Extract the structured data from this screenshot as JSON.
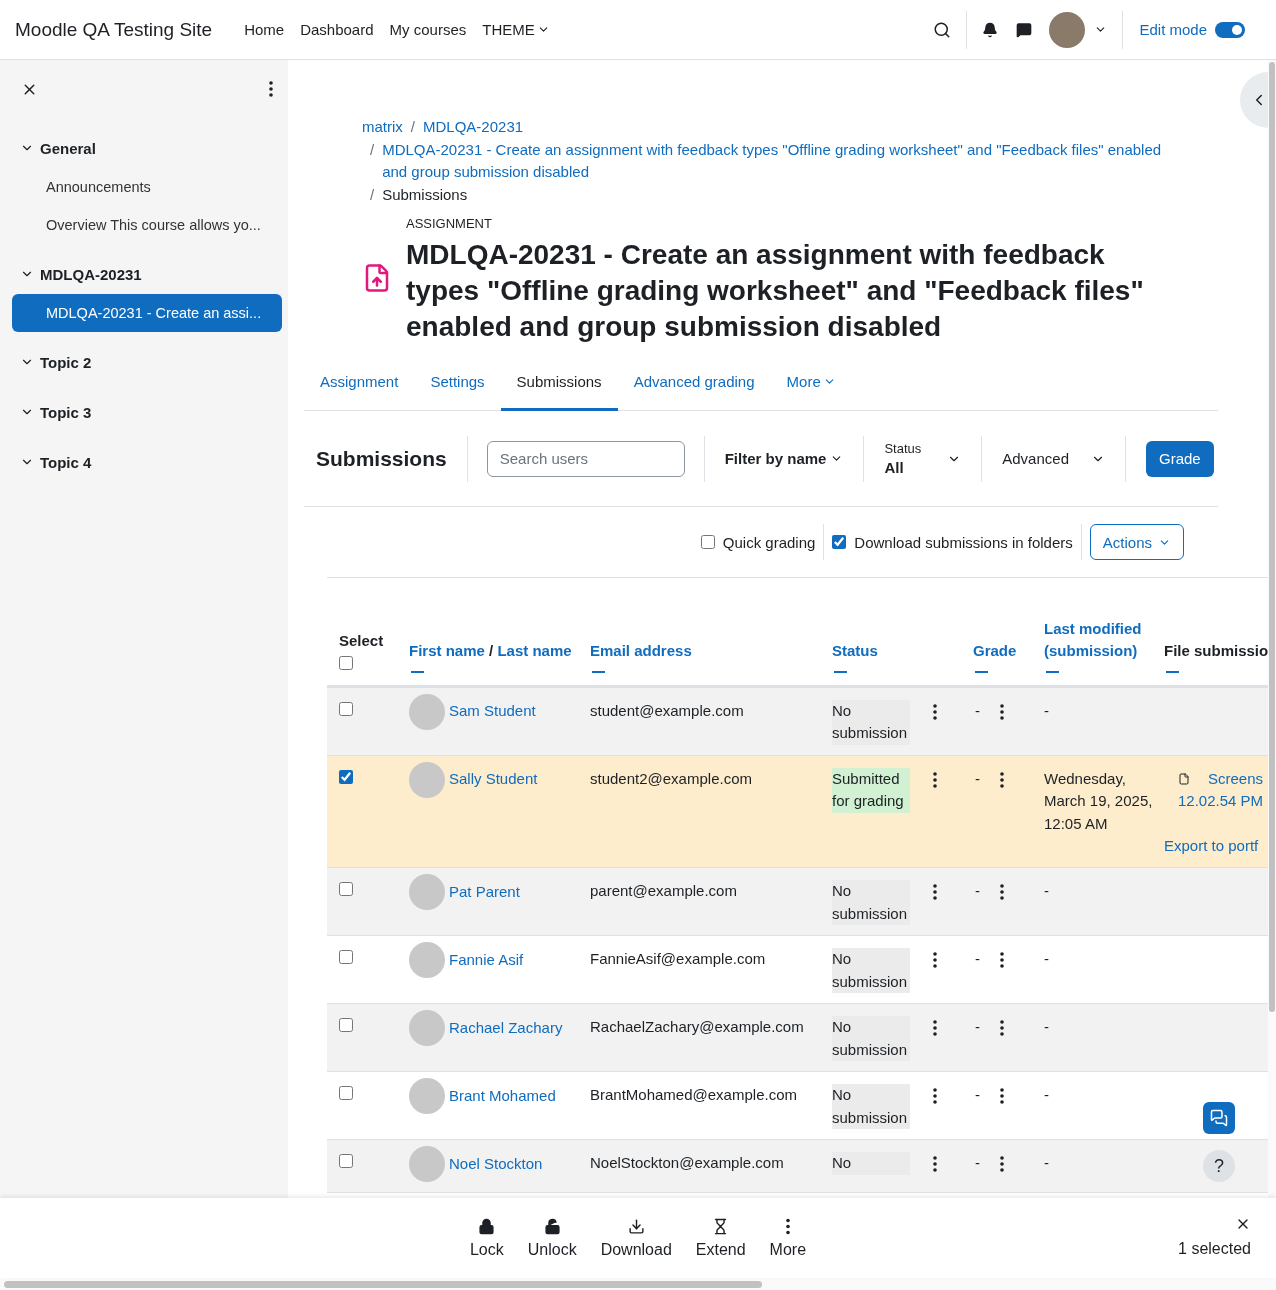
{
  "header": {
    "site_name": "Moodle QA Testing Site",
    "nav": [
      {
        "label": "Home",
        "has_menu": false
      },
      {
        "label": "Dashboard",
        "has_menu": false
      },
      {
        "label": "My courses",
        "has_menu": false
      },
      {
        "label": "THEME",
        "has_menu": true
      }
    ],
    "edit_mode": {
      "label": "Edit mode",
      "on": true
    }
  },
  "sidebar": {
    "sections": [
      {
        "label": "General",
        "expanded": true,
        "children": [
          {
            "label": "Announcements",
            "selected": false
          },
          {
            "label": "Overview This course allows yo...",
            "selected": false
          }
        ]
      },
      {
        "label": "MDLQA-20231",
        "expanded": true,
        "children": [
          {
            "label": "MDLQA-20231 - Create an assi...",
            "selected": true
          }
        ]
      },
      {
        "label": "Topic 2",
        "expanded": true
      },
      {
        "label": "Topic 3",
        "expanded": true
      },
      {
        "label": "Topic 4",
        "expanded": true
      }
    ]
  },
  "breadcrumb": [
    {
      "label": "matrix",
      "link": true
    },
    {
      "separator": "/",
      "label": "MDLQA-20231",
      "link": true
    },
    {
      "separator": "/",
      "label": "MDLQA-20231 - Create an assignment with feedback types \"Offline grading worksheet\" and \"Feedback files\" enabled and group submission disabled",
      "link": true
    },
    {
      "separator": "/",
      "label": "Submissions",
      "link": false
    }
  ],
  "page": {
    "kicker": "ASSIGNMENT",
    "title": "MDLQA-20231 - Create an assignment with feedback types \"Offline grading worksheet\" and \"Feedback files\" enabled and group submission disabled"
  },
  "tabs": [
    {
      "label": "Assignment",
      "selected": false,
      "has_menu": false
    },
    {
      "label": "Settings",
      "selected": false,
      "has_menu": false
    },
    {
      "label": "Submissions",
      "selected": true,
      "has_menu": false
    },
    {
      "label": "Advanced grading",
      "selected": false,
      "has_menu": false
    },
    {
      "label": "More",
      "selected": false,
      "has_menu": true
    }
  ],
  "toolbar": {
    "heading": "Submissions",
    "search": {
      "placeholder": "Search users"
    },
    "filter": "Filter by name",
    "status": {
      "label": "Status",
      "value": "All"
    },
    "advanced": "Advanced",
    "grade": "Grade"
  },
  "options": [
    {
      "label": "Quick grading",
      "checked": false
    },
    {
      "label": "Download submissions in folders",
      "checked": true
    }
  ],
  "actions_button": "Actions",
  "table": {
    "select": {
      "label": "Select",
      "checked": false
    },
    "name_column": {
      "first": "First name",
      "separator": "/",
      "last": "Last name"
    },
    "columns": [
      {
        "label": "Email address",
        "sortable": true
      },
      {
        "label": "Status",
        "sortable": true
      },
      {
        "label": "Grade",
        "sortable": true
      },
      {
        "label": "Last modified (submission)",
        "sortable": true
      },
      {
        "label": "File submissio",
        "sortable": false
      }
    ],
    "rows": [
      {
        "selected": false,
        "name": "Sam Student",
        "email": "student@example.com",
        "status": "No submission",
        "kind": "none",
        "grade": "-",
        "last_modified": "-"
      },
      {
        "selected": true,
        "name": "Sally Student",
        "email": "student2@example.com",
        "status": "Submitted for grading",
        "kind": "submitted",
        "grade": "-",
        "last_modified": "Wednesday, March 19, 2025, 12:05 AM",
        "file_lines": [
          "Screens",
          "12.02.54 PM"
        ],
        "export": "Export to portf"
      },
      {
        "selected": false,
        "name": "Pat Parent",
        "email": "parent@example.com",
        "status": "No submission",
        "kind": "none",
        "grade": "-",
        "last_modified": "-"
      },
      {
        "selected": false,
        "name": "Fannie Asif",
        "email": "FannieAsif@example.com",
        "status": "No submission",
        "kind": "none",
        "grade": "-",
        "last_modified": "-"
      },
      {
        "selected": false,
        "name": "Rachael Zachary",
        "email": "RachaelZachary@example.com",
        "status": "No submission",
        "kind": "none",
        "grade": "-",
        "last_modified": "-"
      },
      {
        "selected": false,
        "name": "Brant Mohamed",
        "email": "BrantMohamed@example.com",
        "status": "No submission",
        "kind": "none",
        "grade": "-",
        "last_modified": "-"
      },
      {
        "selected": false,
        "name": "Noel Stockton",
        "email": "NoelStockton@example.com",
        "status": "No",
        "kind": "none",
        "grade": "-",
        "last_modified": "-"
      }
    ]
  },
  "help_button": "?",
  "footer": {
    "actions": [
      {
        "label": "Lock",
        "kind": "lock"
      },
      {
        "label": "Unlock",
        "kind": "unlock"
      },
      {
        "label": "Download",
        "kind": "download"
      },
      {
        "label": "Extend",
        "kind": "extend"
      },
      {
        "label": "More",
        "kind": "more"
      }
    ],
    "selected_count": "1 selected"
  }
}
